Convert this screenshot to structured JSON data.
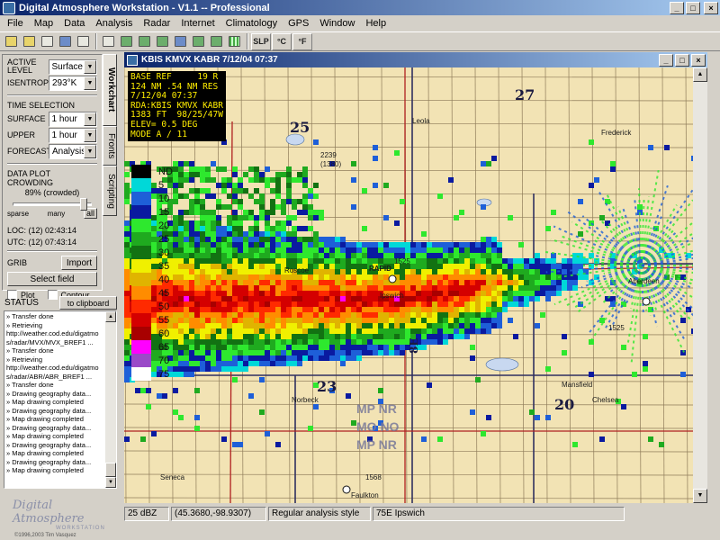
{
  "app": {
    "title": "Digital Atmosphere  Workstation - V1.1 -- Professional",
    "window_buttons": [
      "_",
      "□",
      "×"
    ]
  },
  "menu": [
    "File",
    "Map",
    "Data",
    "Analysis",
    "Radar",
    "Internet",
    "Climatology",
    "GPS",
    "Window",
    "Help"
  ],
  "toolbar": {
    "buttons": [
      "open-icon",
      "folder-icon",
      "print-icon",
      "satellite-icon",
      "copy-icon",
      "new-icon",
      "pencil-icon",
      "chart-icon",
      "zoom-region-icon",
      "globe-icon",
      "zoom-in-icon",
      "zoom-out-icon",
      "grid-icon"
    ],
    "slp_label": "SLP",
    "celsius_label": "°C",
    "fahrenheit_label": "°F"
  },
  "workchart": {
    "active_level_label": "ACTIVE LEVEL",
    "active_level_value": "Surface",
    "isentrop_label": "ISENTROP",
    "isentrop_value": "293°K",
    "time_selection_title": "TIME SELECTION",
    "surface_label": "SURFACE",
    "surface_value": "1 hour",
    "upper_label": "UPPER",
    "upper_value": "1 hour",
    "forecast_label": "FORECAST",
    "forecast_value": "Analysis",
    "crowding_title": "DATA PLOT CROWDING",
    "crowding_value": "89% (crowded)",
    "crowding_fraction": 0.89,
    "tick_sparse": "sparse",
    "tick_many": "many",
    "tick_all": "all",
    "loc_time": "LOC: (12) 02:43:14",
    "utc_time": "UTC: (12) 07:43:14",
    "grib_label": "GRIB",
    "import_label": "Import",
    "select_field_label": "Select field",
    "plot_label": "Plot",
    "contour_label": "Contour"
  },
  "tabs": [
    "Workchart",
    "Fronts",
    "Scripting"
  ],
  "status": {
    "header": "STATUS",
    "clipboard_button": "to clipboard",
    "lines": [
      "» Transfer done",
      "» Retrieving",
      "http://weather.cod.edu/digatmo",
      "s/radar/MVX/MVX_BREF1 ...",
      "» Transfer done",
      "» Retrieving",
      "http://weather.cod.edu/digatmo",
      "s/radar/ABR/ABR_BREF1 ...",
      "» Transfer done",
      "» Drawing geography data...",
      "» Map drawing completed",
      "» Drawing geography data...",
      "» Map drawing completed",
      "» Drawing geography data...",
      "» Map drawing completed",
      "» Drawing geography data...",
      "» Map drawing completed",
      "» Drawing geography data...",
      "» Map drawing completed"
    ]
  },
  "logo": {
    "name": "Digital Atmosphere",
    "sub": "WORKSTATION",
    "copyright": "©1996,2003 Tim Vasquez"
  },
  "map_window": {
    "title": "KBIS KMVX KABR 7/12/04 07:37",
    "info_lines": [
      "BASE REF     19 R",
      "124 NM .54 NM RES",
      "7/12/04 07:37",
      "RDA:KBIS KMVX KABR",
      "1383 FT  98/25/47W",
      "ELEV= 0.5 DEG",
      "MODE A / 11"
    ],
    "legend": [
      {
        "label": "ND",
        "color": "#000000"
      },
      {
        "label": "5",
        "color": "#00d8d8"
      },
      {
        "label": "10",
        "color": "#1e5fd8"
      },
      {
        "label": "15",
        "color": "#0a1aa0"
      },
      {
        "label": "20",
        "color": "#2ee82e"
      },
      {
        "label": "25",
        "color": "#1faa1f"
      },
      {
        "label": "30",
        "color": "#127212"
      },
      {
        "label": "35",
        "color": "#f0f000"
      },
      {
        "label": "40",
        "color": "#e0b400"
      },
      {
        "label": "45",
        "color": "#ff8c00"
      },
      {
        "label": "50",
        "color": "#ff2a00"
      },
      {
        "label": "55",
        "color": "#d40000"
      },
      {
        "label": "60",
        "color": "#a80000"
      },
      {
        "label": "65",
        "color": "#ff00ff"
      },
      {
        "label": "70",
        "color": "#9a4ac8"
      },
      {
        "label": "75",
        "color": "#ffffff"
      }
    ],
    "labels": {
      "n27": "27",
      "n25": "25",
      "n23": "23",
      "n20": "20",
      "scale8e": "8E",
      "leola": "Leola",
      "roscoe": "Roscoe",
      "ipswich": "Ipswich",
      "mansfield": "Mansfield",
      "chelsea": "Chelsea",
      "norbeck": "Norbeck",
      "seneca": "Seneca",
      "faulkton": "Faulkton",
      "frederick": "Frederick",
      "aberdeen": "Aberdeen",
      "mp_nr_1": "MP  NR",
      "mo_no": "MO  NO",
      "mp_nr_2": "MP  NR",
      "rapid": "RAPID",
      "r2239": "2239",
      "r1380": "(1380)",
      "r1525": "1525",
      "r1568": "1568",
      "r1525b": "1525"
    }
  },
  "statusbar": {
    "dbz": "25 dBZ",
    "coords": "(45.3680,-98.9307)",
    "style": "Regular analysis style",
    "location": "75E Ipswich"
  },
  "colors": {
    "titlebar_start": "#0a246a",
    "titlebar_end": "#a6caf0",
    "panel_bg": "#d4d0c8",
    "map_bg": "#f2e3b4"
  }
}
